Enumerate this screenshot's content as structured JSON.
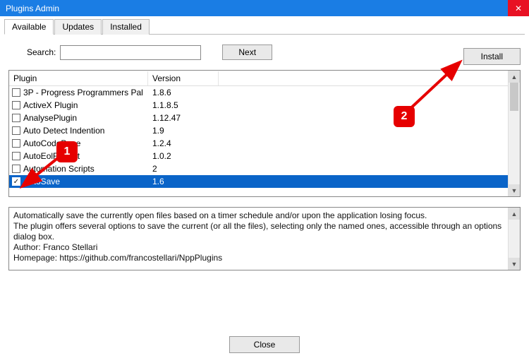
{
  "window": {
    "title": "Plugins Admin"
  },
  "tabs": {
    "available": "Available",
    "updates": "Updates",
    "installed": "Installed"
  },
  "search": {
    "label": "Search:",
    "value": "",
    "next": "Next"
  },
  "buttons": {
    "install": "Install",
    "close": "Close"
  },
  "columns": {
    "plugin": "Plugin",
    "version": "Version"
  },
  "plugins": [
    {
      "name": "3P - Progress Programmers Pal",
      "version": "1.8.6",
      "checked": false,
      "selected": false
    },
    {
      "name": "ActiveX Plugin",
      "version": "1.1.8.5",
      "checked": false,
      "selected": false
    },
    {
      "name": "AnalysePlugin",
      "version": "1.12.47",
      "checked": false,
      "selected": false
    },
    {
      "name": "Auto Detect Indention",
      "version": "1.9",
      "checked": false,
      "selected": false
    },
    {
      "name": "AutoCodePage",
      "version": "1.2.4",
      "checked": false,
      "selected": false
    },
    {
      "name": "AutoEolFormat",
      "version": "1.0.2",
      "checked": false,
      "selected": false
    },
    {
      "name": "Automation Scripts",
      "version": "2",
      "checked": false,
      "selected": false
    },
    {
      "name": "AutoSave",
      "version": "1.6",
      "checked": true,
      "selected": true
    }
  ],
  "description": {
    "line1": "Automatically save the currently open files based on a timer schedule and/or upon the application losing focus.",
    "line2": "The plugin offers several options to save the current (or all the files), selecting only the named ones, accessible through an options dialog box.",
    "author": "Author: Franco Stellari",
    "homepage": "Homepage: https://github.com/francostellari/NppPlugins"
  },
  "annotations": {
    "badge1": "1",
    "badge2": "2"
  }
}
